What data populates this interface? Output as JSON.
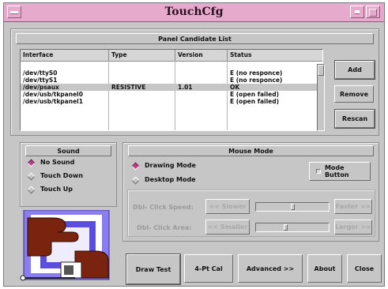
{
  "window": {
    "title": "TouchCfg"
  },
  "panel": {
    "title": "Panel Candidate List",
    "columns": [
      "Interface",
      "Type",
      "Version",
      "Status"
    ],
    "rows": [
      [
        "/dev/ttyS0",
        "",
        "",
        "E (no responce)"
      ],
      [
        "/dev/ttyS1",
        "",
        "",
        "E (no responce)"
      ],
      [
        "/dev/psaux",
        "RESISTIVE",
        "1.01",
        "OK"
      ],
      [
        "/dev/usb/tkpanel0",
        "",
        "",
        "E (open failed)"
      ],
      [
        "/dev/usb/tkpanel1",
        "",
        "",
        "E (open failed)"
      ]
    ],
    "selected_row": 2,
    "buttons": {
      "add": "Add",
      "remove": "Remove",
      "rescan": "Rescan"
    }
  },
  "sound": {
    "title": "Sound",
    "options": [
      "No Sound",
      "Touch Down",
      "Touch Up"
    ],
    "selected": "No Sound"
  },
  "mouse_mode": {
    "title": "Mouse Mode",
    "options": [
      "Drawing Mode",
      "Desktop Mode"
    ],
    "selected": "Drawing Mode",
    "mode_button": "Mode Button",
    "dbl_click_speed": {
      "label": "Dbl- Click Speed:",
      "slower": "<< Slower",
      "faster": "Faster >>",
      "value": 0.5
    },
    "dbl_click_area": {
      "label": "Dbl- Click Area:",
      "smaller": "<< Smaller",
      "larger": "Larger >>",
      "value": 0.4
    }
  },
  "actions": {
    "draw_test": "Draw Test",
    "cal": "4-Pt Cal",
    "advanced": "Advanced >>",
    "about": "About",
    "close": "Close"
  },
  "colors": {
    "title_bar": "#e6aacd",
    "radio_on": "#c23a8a",
    "logo_frame": "#8a7df0"
  }
}
